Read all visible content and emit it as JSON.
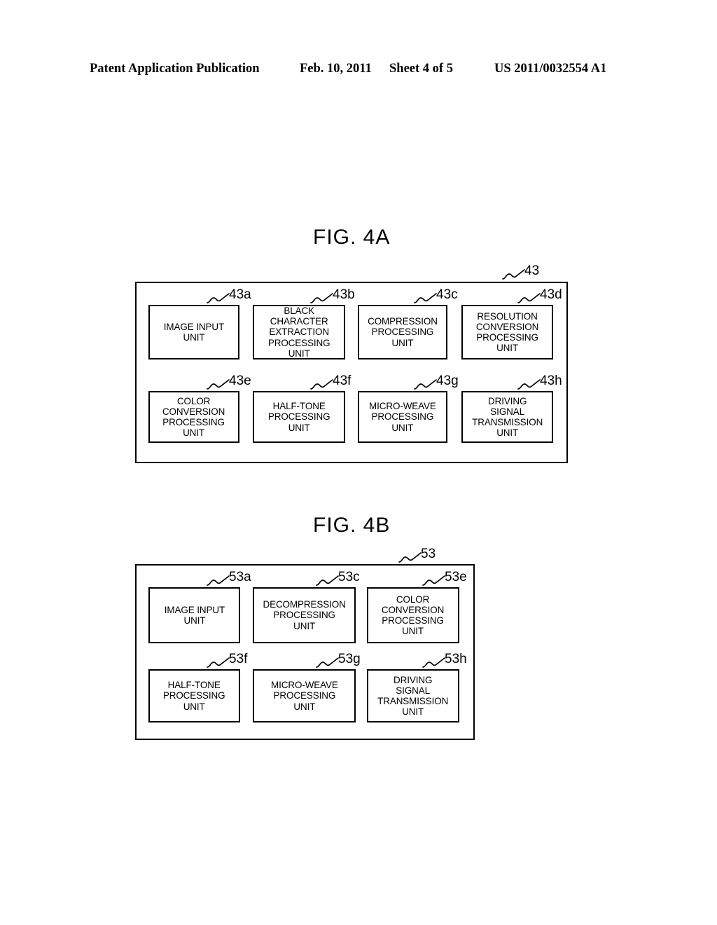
{
  "header": {
    "publication": "Patent Application Publication",
    "date": "Feb. 10, 2011",
    "sheet": "Sheet 4 of 5",
    "document_number": "US 2011/0032554 A1"
  },
  "figures": [
    {
      "id": "fig4a",
      "title": "FIG. 4A",
      "container_ref": "43",
      "units": [
        {
          "ref": "43a",
          "label": "IMAGE INPUT\nUNIT"
        },
        {
          "ref": "43b",
          "label": "BLACK\nCHARACTER\nEXTRACTION\nPROCESSING\nUNIT"
        },
        {
          "ref": "43c",
          "label": "COMPRESSION\nPROCESSING\nUNIT"
        },
        {
          "ref": "43d",
          "label": "RESOLUTION\nCONVERSION\nPROCESSING\nUNIT"
        },
        {
          "ref": "43e",
          "label": "COLOR\nCONVERSION\nPROCESSING\nUNIT"
        },
        {
          "ref": "43f",
          "label": "HALF-TONE\nPROCESSING\nUNIT"
        },
        {
          "ref": "43g",
          "label": "MICRO-WEAVE\nPROCESSING\nUNIT"
        },
        {
          "ref": "43h",
          "label": "DRIVING\nSIGNAL\nTRANSMISSION\nUNIT"
        }
      ]
    },
    {
      "id": "fig4b",
      "title": "FIG. 4B",
      "container_ref": "53",
      "units": [
        {
          "ref": "53a",
          "label": "IMAGE INPUT\nUNIT"
        },
        {
          "ref": "53c",
          "label": "DECOMPRESSION\nPROCESSING\nUNIT"
        },
        {
          "ref": "53e",
          "label": "COLOR\nCONVERSION\nPROCESSING\nUNIT"
        },
        {
          "ref": "53f",
          "label": "HALF-TONE\nPROCESSING\nUNIT"
        },
        {
          "ref": "53g",
          "label": "MICRO-WEAVE\nPROCESSING\nUNIT"
        },
        {
          "ref": "53h",
          "label": "DRIVING\nSIGNAL\nTRANSMISSION\nUNIT"
        }
      ]
    }
  ],
  "colors": {
    "ink": "#000000",
    "paper": "#ffffff"
  }
}
